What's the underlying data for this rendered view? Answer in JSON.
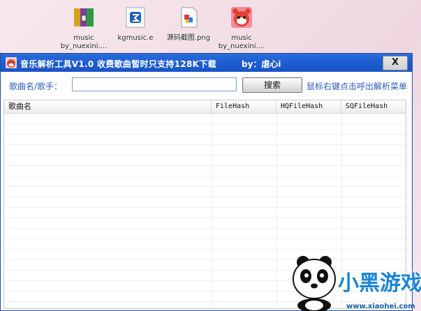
{
  "desktop": {
    "icons": [
      {
        "label_line1": "music",
        "label_line2": "by_nuexini....",
        "icon": "winrar-archive-icon"
      },
      {
        "label_line1": "kgmusic.e",
        "label_line2": "",
        "icon": "kgmusic-exe-icon"
      },
      {
        "label_line1": "源码截图.png",
        "label_line2": "",
        "icon": "png-image-icon"
      },
      {
        "label_line1": "music",
        "label_line2": "by_nuexini....",
        "icon": "red-panda-app-icon"
      }
    ]
  },
  "window": {
    "title": "音乐解析工具V1.0  收费歌曲暂时只支持128K下载",
    "author": "by：虐心i",
    "close_label": "X"
  },
  "toolbar": {
    "song_label": "歌曲名/歌手：",
    "search_value": "",
    "search_button": "搜索",
    "hint": "鼠标右键点击呼出解析菜单"
  },
  "list": {
    "columns": [
      "歌曲名",
      "FileHash",
      "HQFileHash",
      "SQFileHash"
    ]
  },
  "colors": {
    "titlebar": "#1f5fd2",
    "label_blue": "#2c5bb8"
  },
  "watermark": {
    "text": "小黑游戏",
    "url": "www.xiaohei.com"
  }
}
